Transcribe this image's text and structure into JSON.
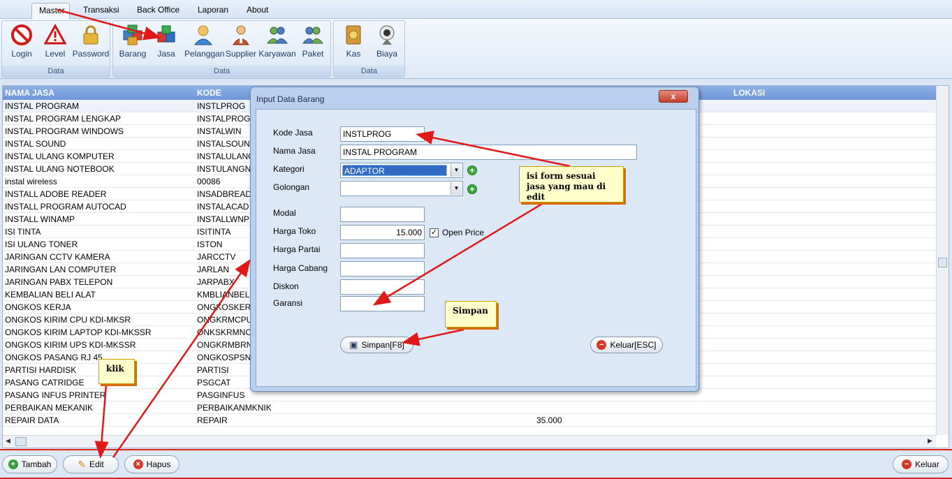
{
  "menu": {
    "tabs": [
      {
        "label": "Master",
        "active": true
      },
      {
        "label": "Transaksi",
        "active": false
      },
      {
        "label": "Back Office",
        "active": false
      },
      {
        "label": "Laporan",
        "active": false
      },
      {
        "label": "About",
        "active": false
      }
    ]
  },
  "ribbon": {
    "groups": [
      {
        "label": "Data",
        "buttons": [
          {
            "label": "Login",
            "icon": "no-entry-icon"
          },
          {
            "label": "Level",
            "icon": "warning-icon"
          },
          {
            "label": "Password",
            "icon": "lock-icon"
          }
        ]
      },
      {
        "label": "Data",
        "buttons": [
          {
            "label": "Barang",
            "icon": "boxes-icon"
          },
          {
            "label": "Jasa",
            "icon": "cubes-icon"
          },
          {
            "label": "Pelanggan",
            "icon": "customer-icon"
          },
          {
            "label": "Supplier",
            "icon": "supplier-icon"
          },
          {
            "label": "Karyawan",
            "icon": "employees-icon"
          },
          {
            "label": "Paket",
            "icon": "package-icon"
          }
        ]
      },
      {
        "label": "Data",
        "buttons": [
          {
            "label": "Kas",
            "icon": "cash-book-icon"
          },
          {
            "label": "Biaya",
            "icon": "webcam-icon"
          }
        ]
      }
    ]
  },
  "grid": {
    "columns": [
      "NAMA JASA",
      "KODE",
      "LOKASI"
    ],
    "rows": [
      {
        "nama": "INSTAL PROGRAM",
        "kode": "INSTLPROG",
        "harga": ""
      },
      {
        "nama": "INSTAL PROGRAM LENGKAP",
        "kode": "INSTALPROGL",
        "harga": ""
      },
      {
        "nama": "INSTAL PROGRAM WINDOWS",
        "kode": "INSTALWIN",
        "harga": ""
      },
      {
        "nama": "INSTAL SOUND",
        "kode": "INSTALSOUND",
        "harga": ""
      },
      {
        "nama": "INSTAL ULANG KOMPUTER",
        "kode": "INSTALULANG",
        "harga": ""
      },
      {
        "nama": "INSTAL ULANG NOTEBOOK",
        "kode": "INSTULANGNB",
        "harga": ""
      },
      {
        "nama": "instal wireless",
        "kode": "00086",
        "harga": ""
      },
      {
        "nama": "INSTALL ADOBE READER",
        "kode": "INSADBREADE",
        "harga": ""
      },
      {
        "nama": "INSTALL PROGRAM AUTOCAD",
        "kode": "INSTALACAD",
        "harga": ""
      },
      {
        "nama": "INSTALL WINAMP",
        "kode": "INSTALLWNP",
        "harga": ""
      },
      {
        "nama": "ISI TINTA",
        "kode": "ISITINTA",
        "harga": ""
      },
      {
        "nama": "ISI ULANG TONER",
        "kode": "ISTON",
        "harga": ""
      },
      {
        "nama": "JARINGAN CCTV KAMERA",
        "kode": "JARCCTV",
        "harga": ""
      },
      {
        "nama": "JARINGAN LAN COMPUTER",
        "kode": "JARLAN",
        "harga": ""
      },
      {
        "nama": "JARINGAN PABX TELEPON",
        "kode": "JARPABX",
        "harga": ""
      },
      {
        "nama": "KEMBALIAN BELI ALAT",
        "kode": "KMBLIANBELIA",
        "harga": ""
      },
      {
        "nama": "ONGKOS KERJA",
        "kode": "ONGKOSKERJA",
        "harga": ""
      },
      {
        "nama": "ONGKOS KIRIM CPU KDI-MKSR",
        "kode": "ONGKRMCPU",
        "harga": ""
      },
      {
        "nama": "ONGKOS KIRIM LAPTOP KDI-MKSSR",
        "kode": "ONKSKRMNOT",
        "harga": ""
      },
      {
        "nama": "ONGKOS KIRIM UPS KDI-MKSSR",
        "kode": "ONGKRMBRNG",
        "harga": ""
      },
      {
        "nama": "ONGKOS PASANG RJ 45",
        "kode": "ONGKOSPSNG",
        "harga": ""
      },
      {
        "nama": "PARTISI HARDISK",
        "kode": "PARTISI",
        "harga": ""
      },
      {
        "nama": "PASANG CATRIDGE",
        "kode": "PSGCAT",
        "harga": ""
      },
      {
        "nama": "PASANG INFUS PRINTER",
        "kode": "PASGINFUS",
        "harga": ""
      },
      {
        "nama": "PERBAIKAN MEKANIK",
        "kode": "PERBAIKANMKNIK",
        "harga": ""
      },
      {
        "nama": "REPAIR DATA",
        "kode": "REPAIR",
        "harga": "35.000"
      }
    ]
  },
  "bottom": {
    "tambah": "Tambah",
    "edit": "Edit",
    "hapus": "Hapus",
    "keluar": "Keluar"
  },
  "dialog": {
    "title": "Input Data Barang",
    "close": "x",
    "fields": {
      "kode_jasa": {
        "label": "Kode Jasa",
        "value": "INSTLPROG"
      },
      "nama_jasa": {
        "label": "Nama Jasa",
        "value": "INSTAL PROGRAM"
      },
      "kategori": {
        "label": "Kategori",
        "value": "ADAPTOR"
      },
      "golongan": {
        "label": "Golongan",
        "value": ""
      },
      "modal": {
        "label": "Modal",
        "value": ""
      },
      "harga_toko": {
        "label": "Harga Toko",
        "value": "15.000"
      },
      "harga_partai": {
        "label": "Harga Partai",
        "value": ""
      },
      "harga_cabang": {
        "label": "Harga Cabang",
        "value": ""
      },
      "diskon": {
        "label": "Diskon",
        "value": ""
      },
      "garansi": {
        "label": "Garansi",
        "value": ""
      }
    },
    "open_price": {
      "label": "Open Price",
      "checked": true
    },
    "simpan": "Simpan[F8]",
    "keluar": "Keluar[ESC]"
  },
  "annotations": {
    "isi_form": "isi form sesuai jasa yang mau di edit",
    "simpan": "Simpan",
    "klik": "klik"
  },
  "colors": {
    "header": "#7aa2de",
    "annotation_arrow": "#e01818",
    "callout_bg": "#ffffcc"
  }
}
